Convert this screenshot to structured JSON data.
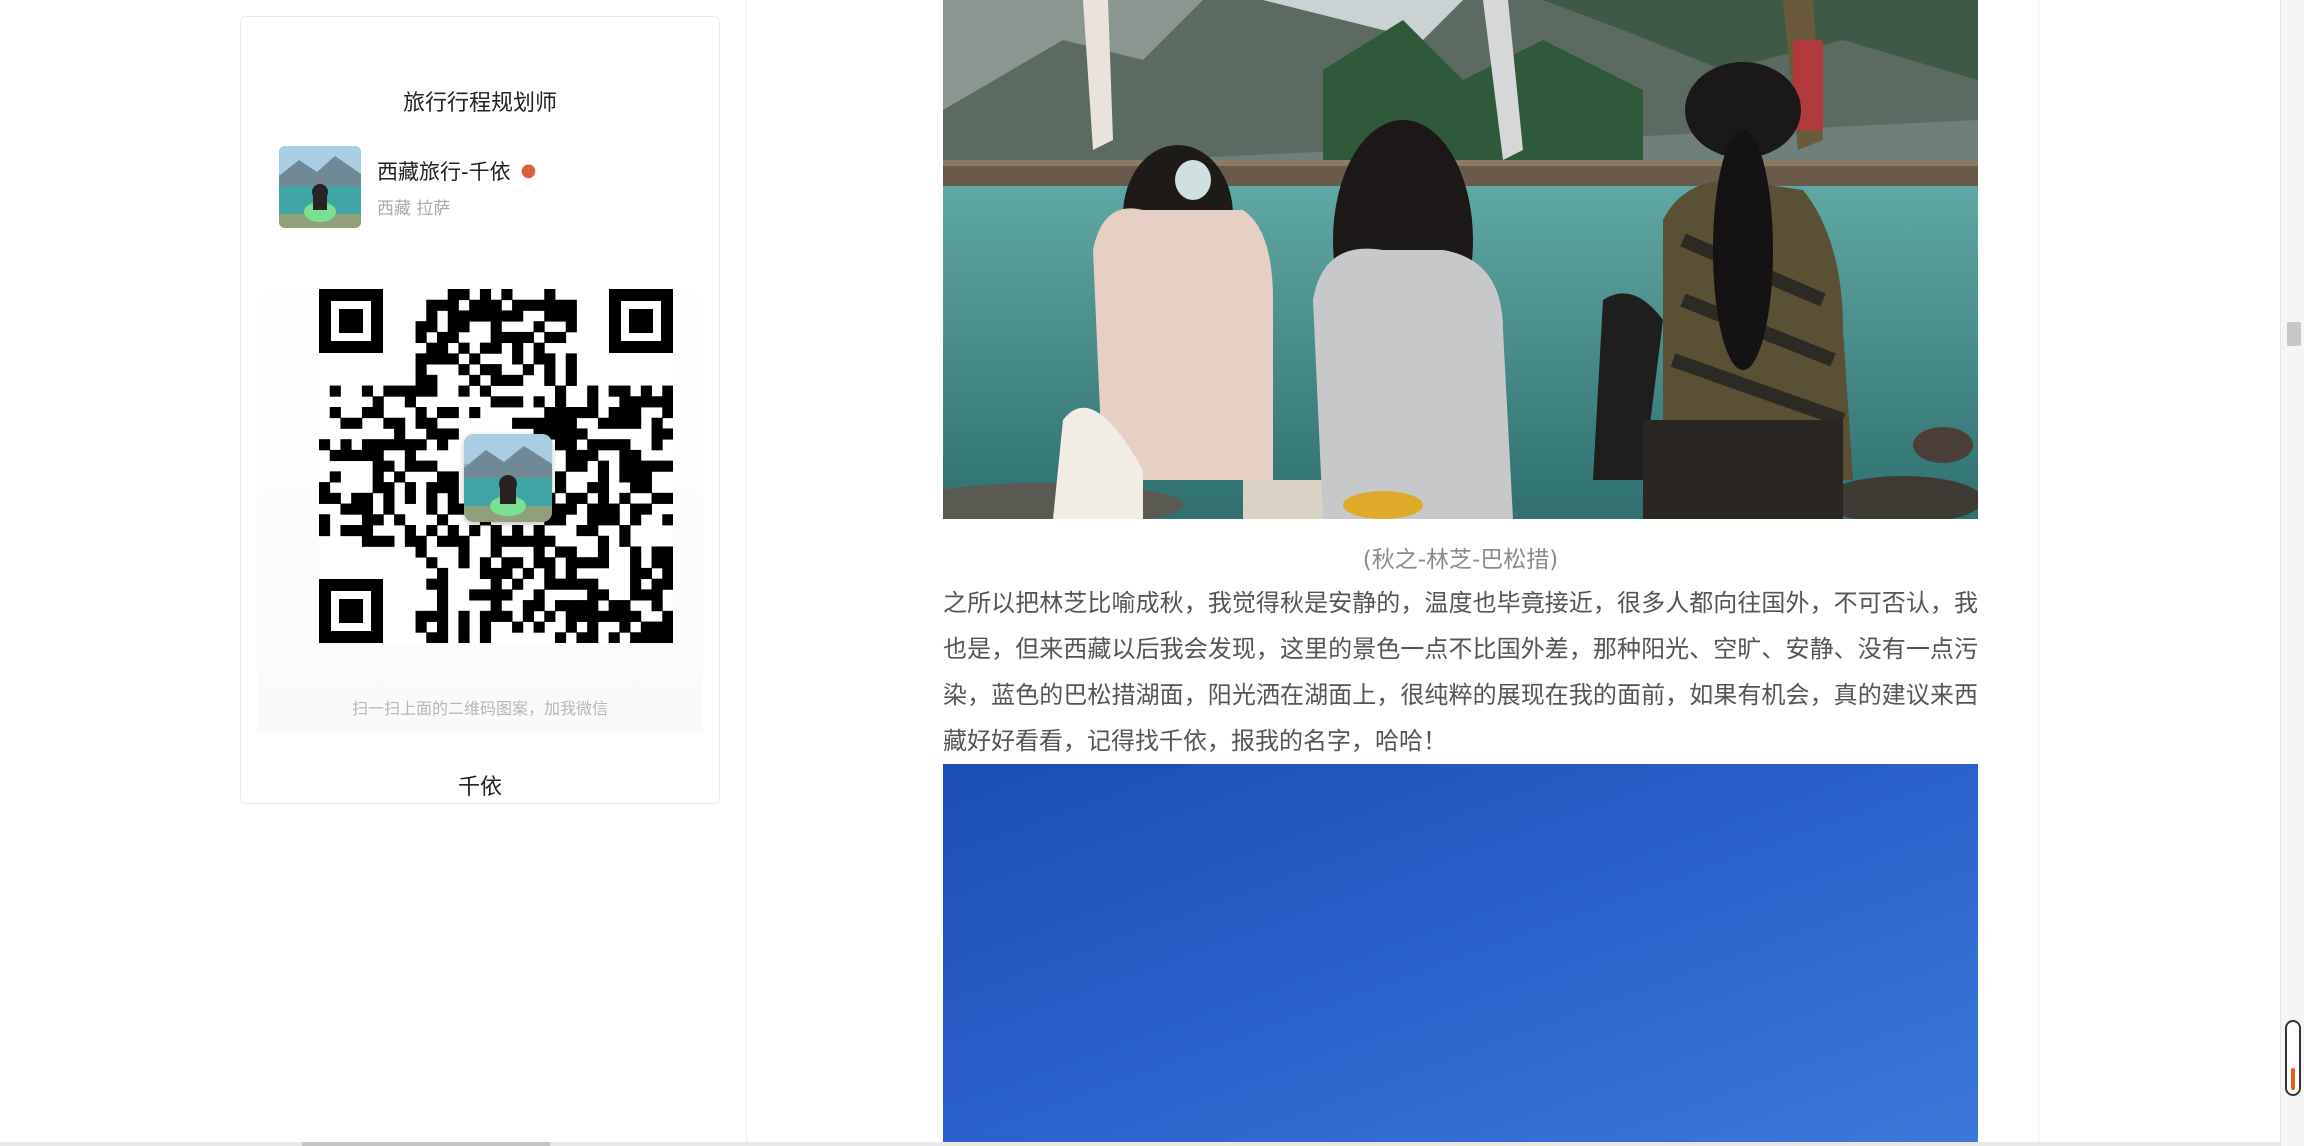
{
  "sidebar": {
    "card_title": "旅行行程规划师",
    "profile": {
      "name": "西藏旅行-千依",
      "location": "西藏 拉萨",
      "emoji_icon": "person-emoji-icon"
    },
    "qr_hint": "扫一扫上面的二维码图案，加我微信",
    "qr_name": "千依"
  },
  "article": {
    "photo_caption": "(秋之-林芝-巴松措)",
    "paragraph": "之所以把林芝比喻成秋，我觉得秋是安静的，温度也毕竟接近，很多人都向往国外，不可否认，我也是，但来西藏以后我会发现，这里的景色一点不比国外差，那种阳光、空旷、安静、没有一点污染，蓝色的巴松措湖面，阳光洒在湖面上，很纯粹的展现在我的面前，如果有机会，真的建议来西藏好好看看，记得找千依，报我的名字，哈哈！"
  },
  "colors": {
    "sky_blue": "#2a5fca",
    "lake_teal": "#3f8f88",
    "scroll_accent": "#e85d1b"
  }
}
